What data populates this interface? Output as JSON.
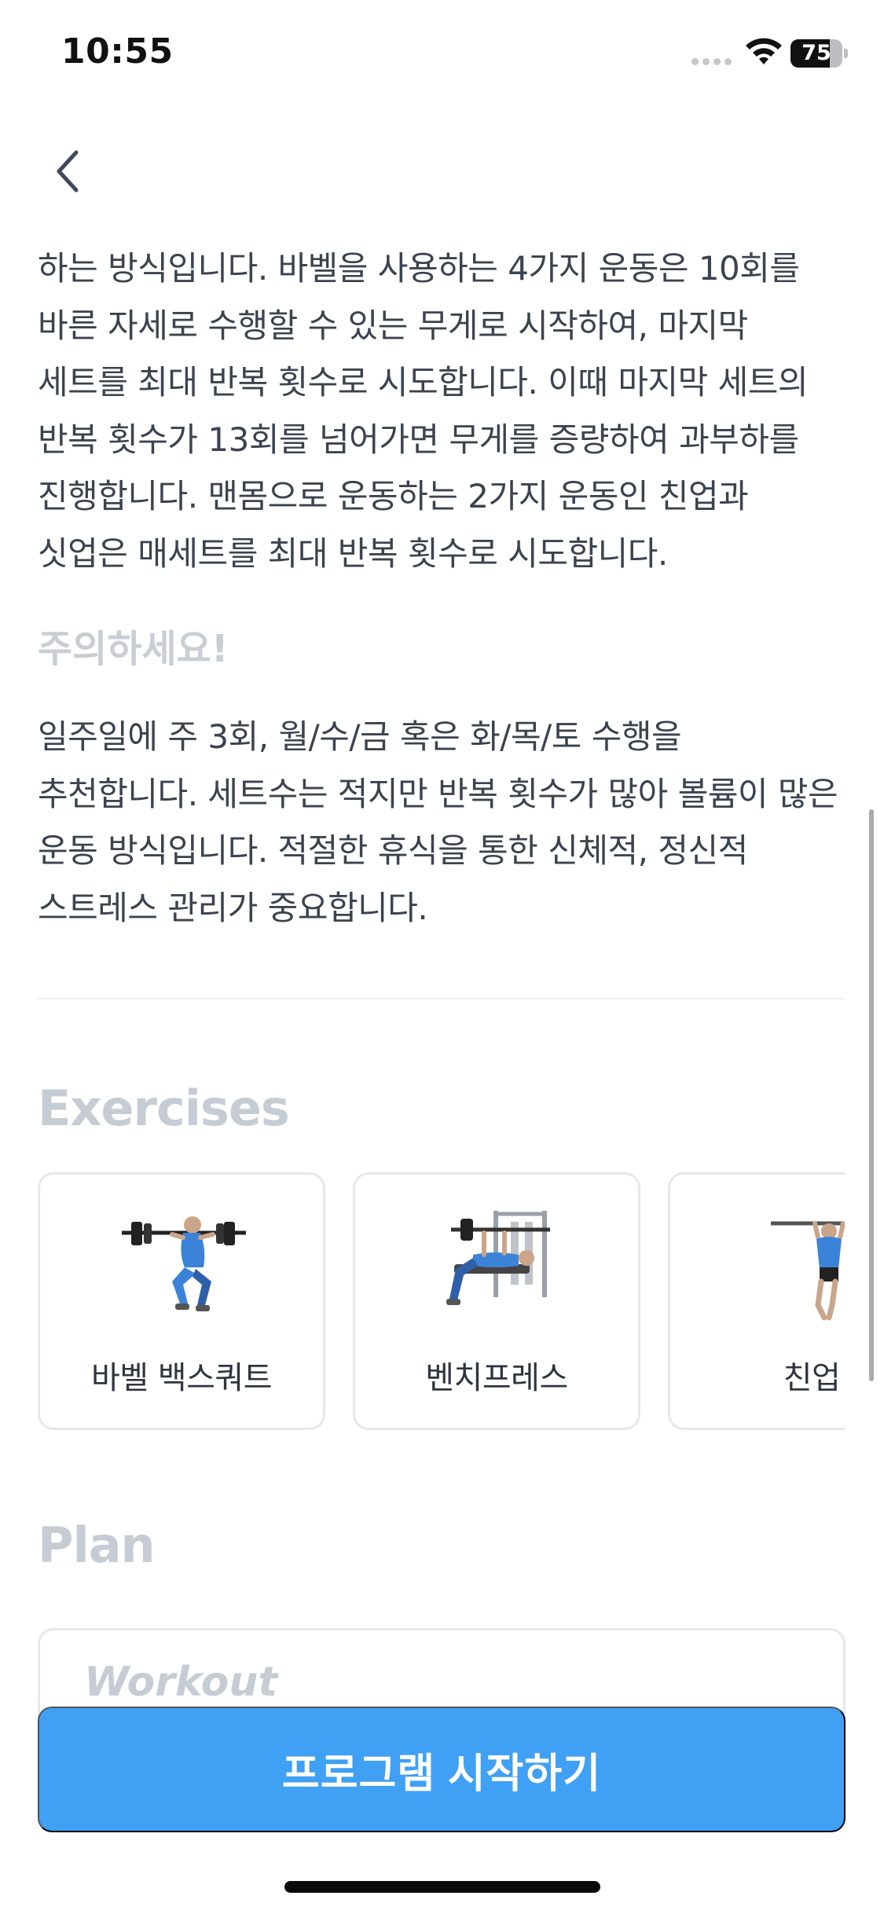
{
  "status_bar": {
    "time": "10:55",
    "battery_level": "75",
    "battery_fraction": 0.75
  },
  "nav": {
    "back_icon": "chevron-left-icon"
  },
  "content": {
    "paragraph_1": "하는 방식입니다. 바벨을 사용하는 4가지 운동은 10회를 바른 자세로 수행할 수 있는 무게로 시작하여, 마지막 세트를 최대 반복 횟수로 시도합니다. 이때 마지막 세트의 반복 횟수가 13회를 넘어가면 무게를 증량하여 과부하를 진행합니다. 맨몸으로 운동하는 2가지 운동인 친업과 싯업은 매세트를 최대 반복 횟수로 시도합니다.",
    "warning_heading": "주의하세요!",
    "paragraph_2": "일주일에 주 3회, 월/수/금 혹은 화/목/토 수행을 추천합니다. 세트수는 적지만 반복 횟수가 많아 볼륨이 많은 운동 방식입니다. 적절한 휴식을 통한 신체적, 정신적 스트레스 관리가 중요합니다."
  },
  "exercises": {
    "title": "Exercises",
    "items": [
      {
        "label": "바벨 백스쿼트",
        "icon": "barbell-back-squat-figure"
      },
      {
        "label": "벤치프레스",
        "icon": "bench-press-figure"
      },
      {
        "label": "친업",
        "icon": "chin-up-figure"
      }
    ]
  },
  "plan": {
    "title": "Plan",
    "card_title": "Workout"
  },
  "cta": {
    "start_label": "프로그램 시작하기"
  },
  "colors": {
    "accent": "#3fa0f4",
    "muted_heading": "#c6ccd4",
    "body_text": "#3b4350",
    "muscle_highlight": "#3b82d9"
  }
}
